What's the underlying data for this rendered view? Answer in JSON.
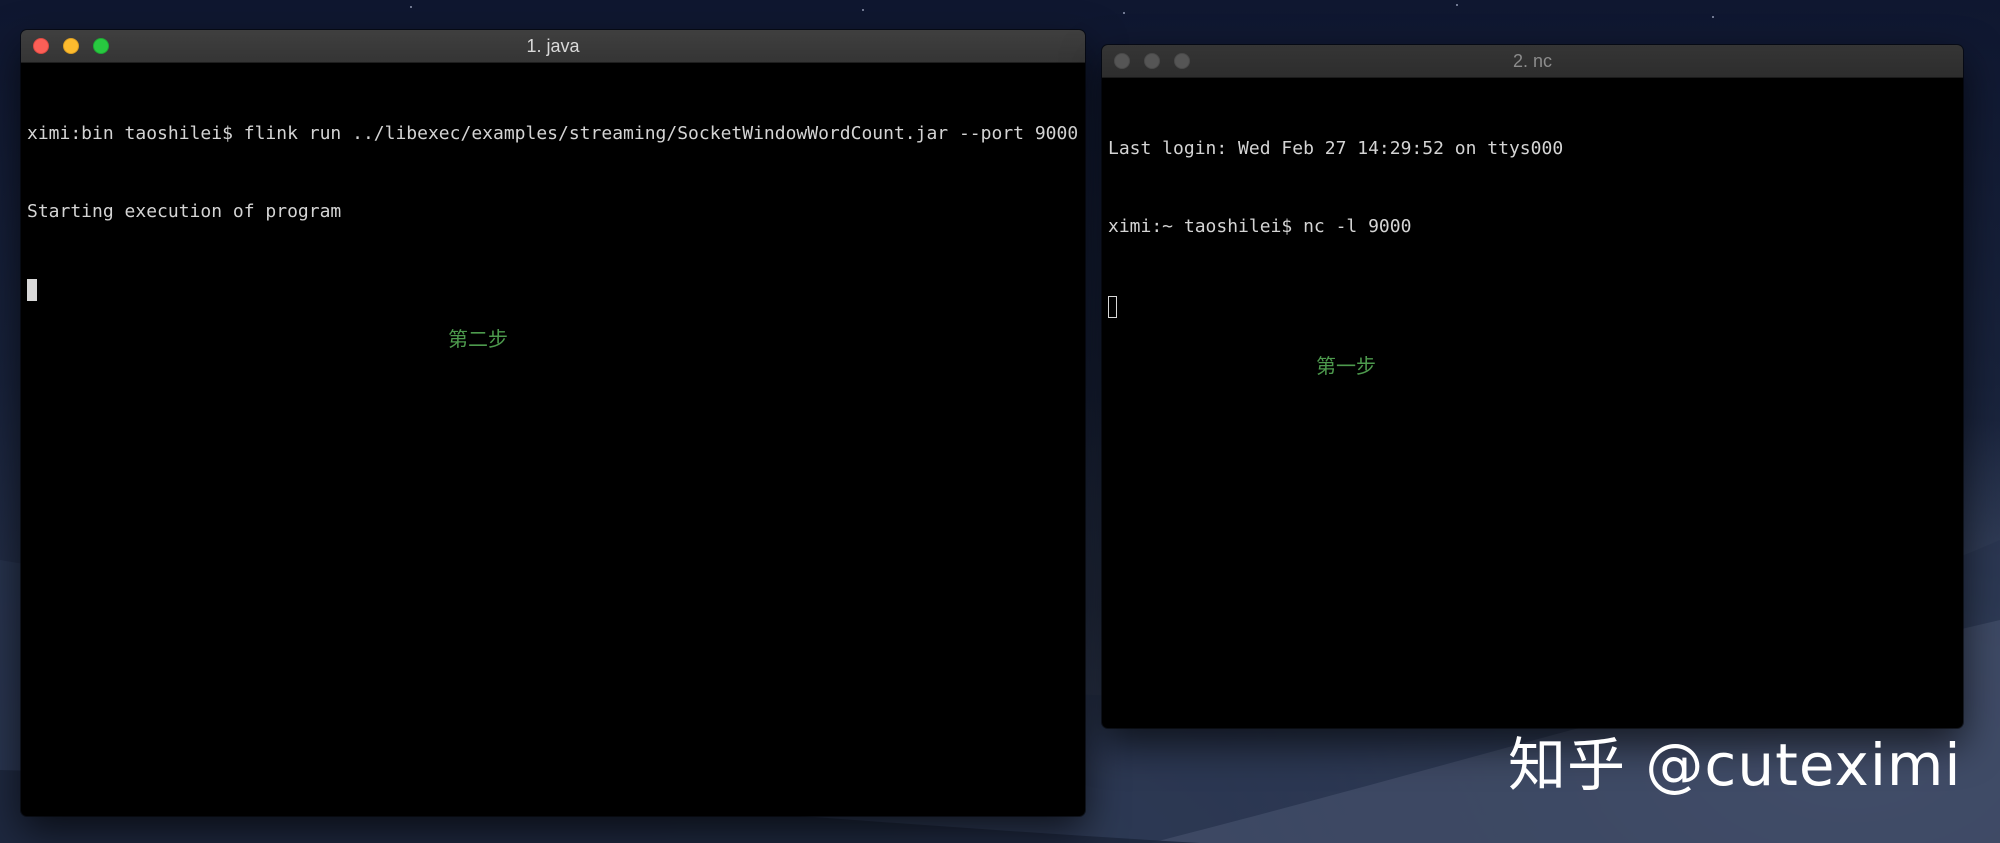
{
  "desktop": {
    "watermark": "知乎 @cuteximi"
  },
  "windows": [
    {
      "title": "1. java",
      "state": "active",
      "lines": [
        "ximi:bin taoshilei$ flink run ../libexec/examples/streaming/SocketWindowWordCount.jar --port 9000",
        "Starting execution of program"
      ],
      "annotation": "第二步"
    },
    {
      "title": "2. nc",
      "state": "inactive",
      "lines": [
        "Last login: Wed Feb 27 14:29:52 on ttys000",
        "ximi:~ taoshilei$ nc -l 9000"
      ],
      "annotation": "第一步"
    }
  ],
  "colors": {
    "annotation": "#4d9a4d",
    "terminal_text": "#d4d4d4",
    "terminal_bg": "#000000",
    "traffic_close": "#fc5f57",
    "traffic_minimize": "#fdbb2e",
    "traffic_zoom": "#28c940"
  }
}
